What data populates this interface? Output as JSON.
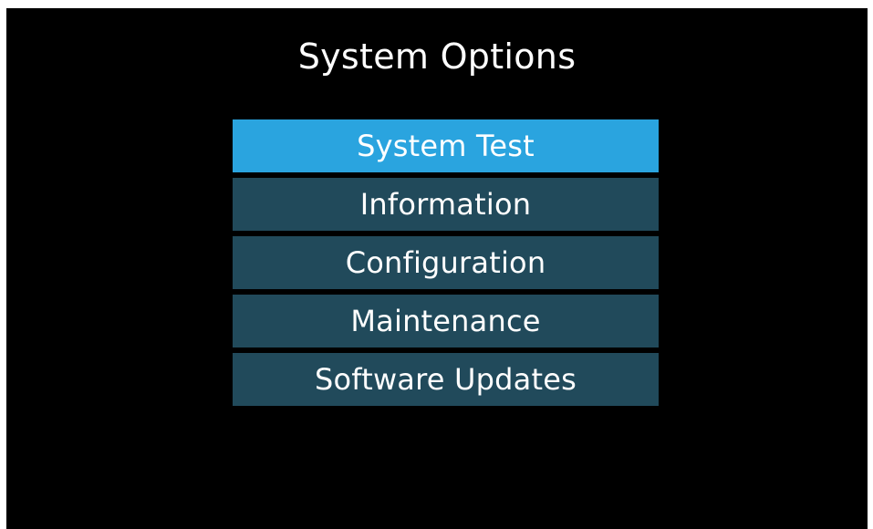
{
  "title": "System Options",
  "menu": {
    "items": [
      {
        "label": "System Test",
        "selected": true
      },
      {
        "label": "Information",
        "selected": false
      },
      {
        "label": "Configuration",
        "selected": false
      },
      {
        "label": "Maintenance",
        "selected": false
      },
      {
        "label": "Software Updates",
        "selected": false
      }
    ]
  },
  "colors": {
    "background": "#000000",
    "item": "#214a5b",
    "selected_item": "#2aa4df",
    "text": "#ffffff"
  }
}
